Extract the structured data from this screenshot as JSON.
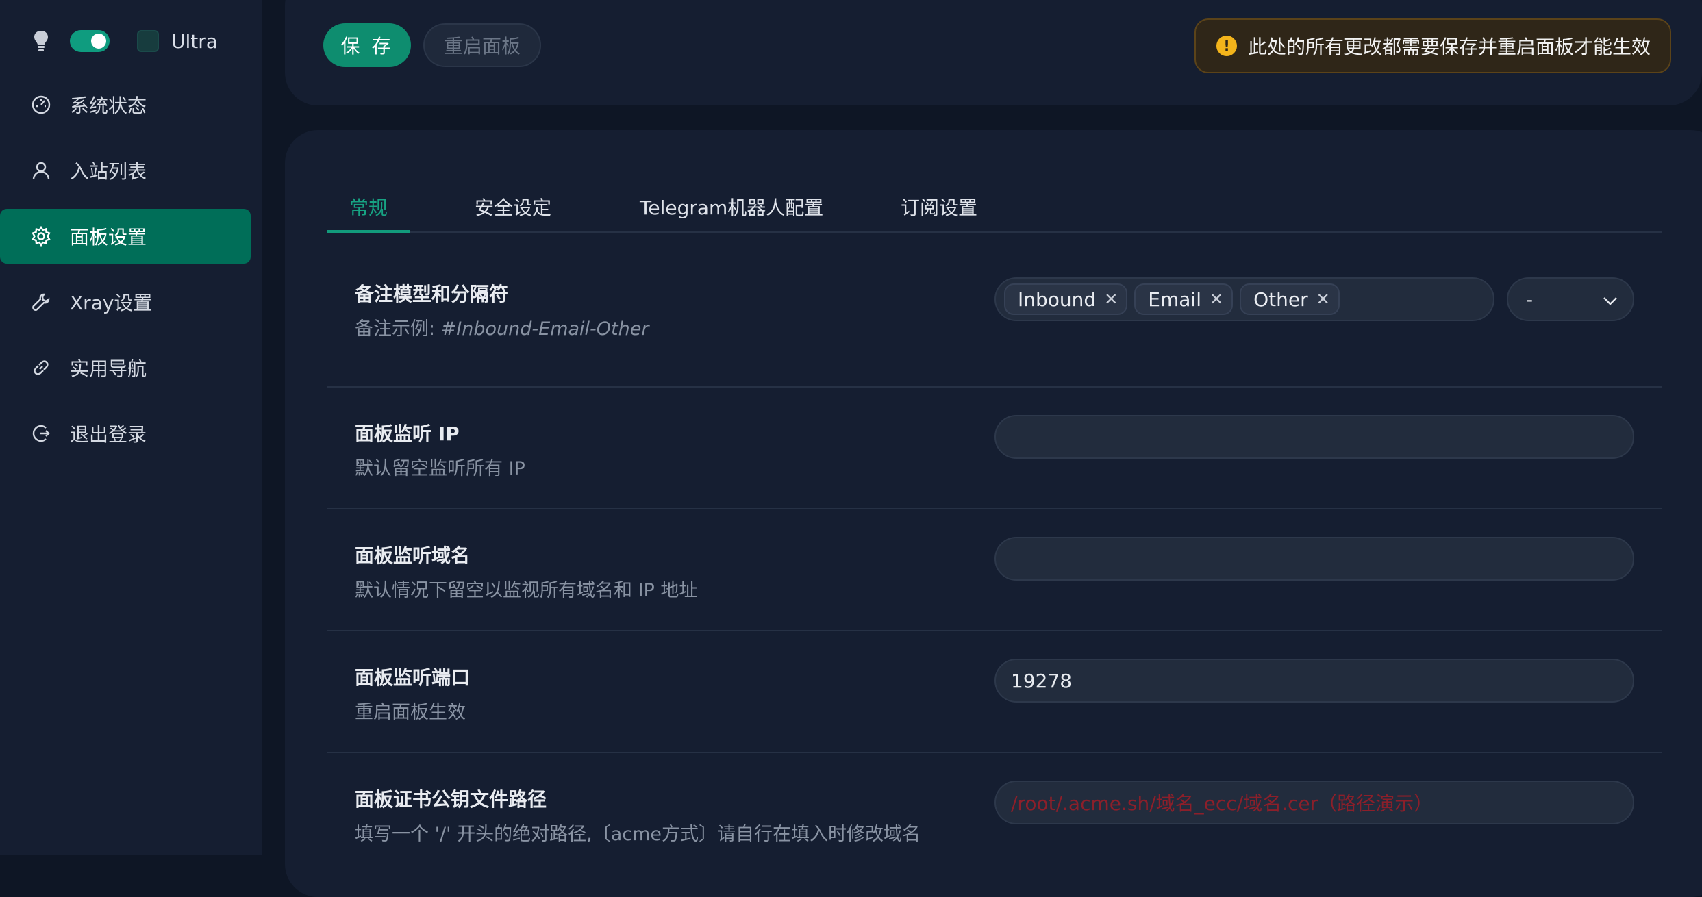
{
  "sidebar": {
    "theme": {
      "ultra_label": "Ultra"
    },
    "items": [
      {
        "label": "系统状态",
        "icon": "dashboard-icon",
        "active": false
      },
      {
        "label": "入站列表",
        "icon": "user-icon",
        "active": false
      },
      {
        "label": "面板设置",
        "icon": "gear-icon",
        "active": true
      },
      {
        "label": "Xray设置",
        "icon": "wrench-icon",
        "active": false
      },
      {
        "label": "实用导航",
        "icon": "link-icon",
        "active": false
      },
      {
        "label": "退出登录",
        "icon": "logout-icon",
        "active": false
      }
    ]
  },
  "toolbar": {
    "save_label": "保 存",
    "restart_label": "重启面板",
    "alert_text": "此处的所有更改都需要保存并重启面板才能生效"
  },
  "tabs": [
    {
      "label": "常规",
      "active": true
    },
    {
      "label": "安全设定",
      "active": false
    },
    {
      "label": "Telegram机器人配置",
      "active": false
    },
    {
      "label": "订阅设置",
      "active": false
    }
  ],
  "settings": {
    "remark": {
      "title": "备注模型和分隔符",
      "desc_prefix": "备注示例: ",
      "desc_example": "#Inbound-Email-Other",
      "tags": [
        "Inbound",
        "Email",
        "Other"
      ],
      "separator": "-"
    },
    "listen_ip": {
      "title": "面板监听 IP",
      "desc": "默认留空监听所有 IP",
      "value": ""
    },
    "listen_domain": {
      "title": "面板监听域名",
      "desc": "默认情况下留空以监视所有域名和 IP 地址",
      "value": ""
    },
    "listen_port": {
      "title": "面板监听端口",
      "desc": "重启面板生效",
      "value": "19278"
    },
    "cert_path": {
      "title": "面板证书公钥文件路径",
      "desc": "填写一个 '/' 开头的绝对路径,〔acme方式〕请自行在填入时修改域名",
      "placeholder": "/root/.acme.sh/域名_ecc/域名.cer（路径演示）"
    }
  },
  "colors": {
    "accent": "#0e8d6f",
    "active_nav": "#006e58",
    "warning": "#f3b41b",
    "placeholder_red": "#8c1f2a"
  }
}
